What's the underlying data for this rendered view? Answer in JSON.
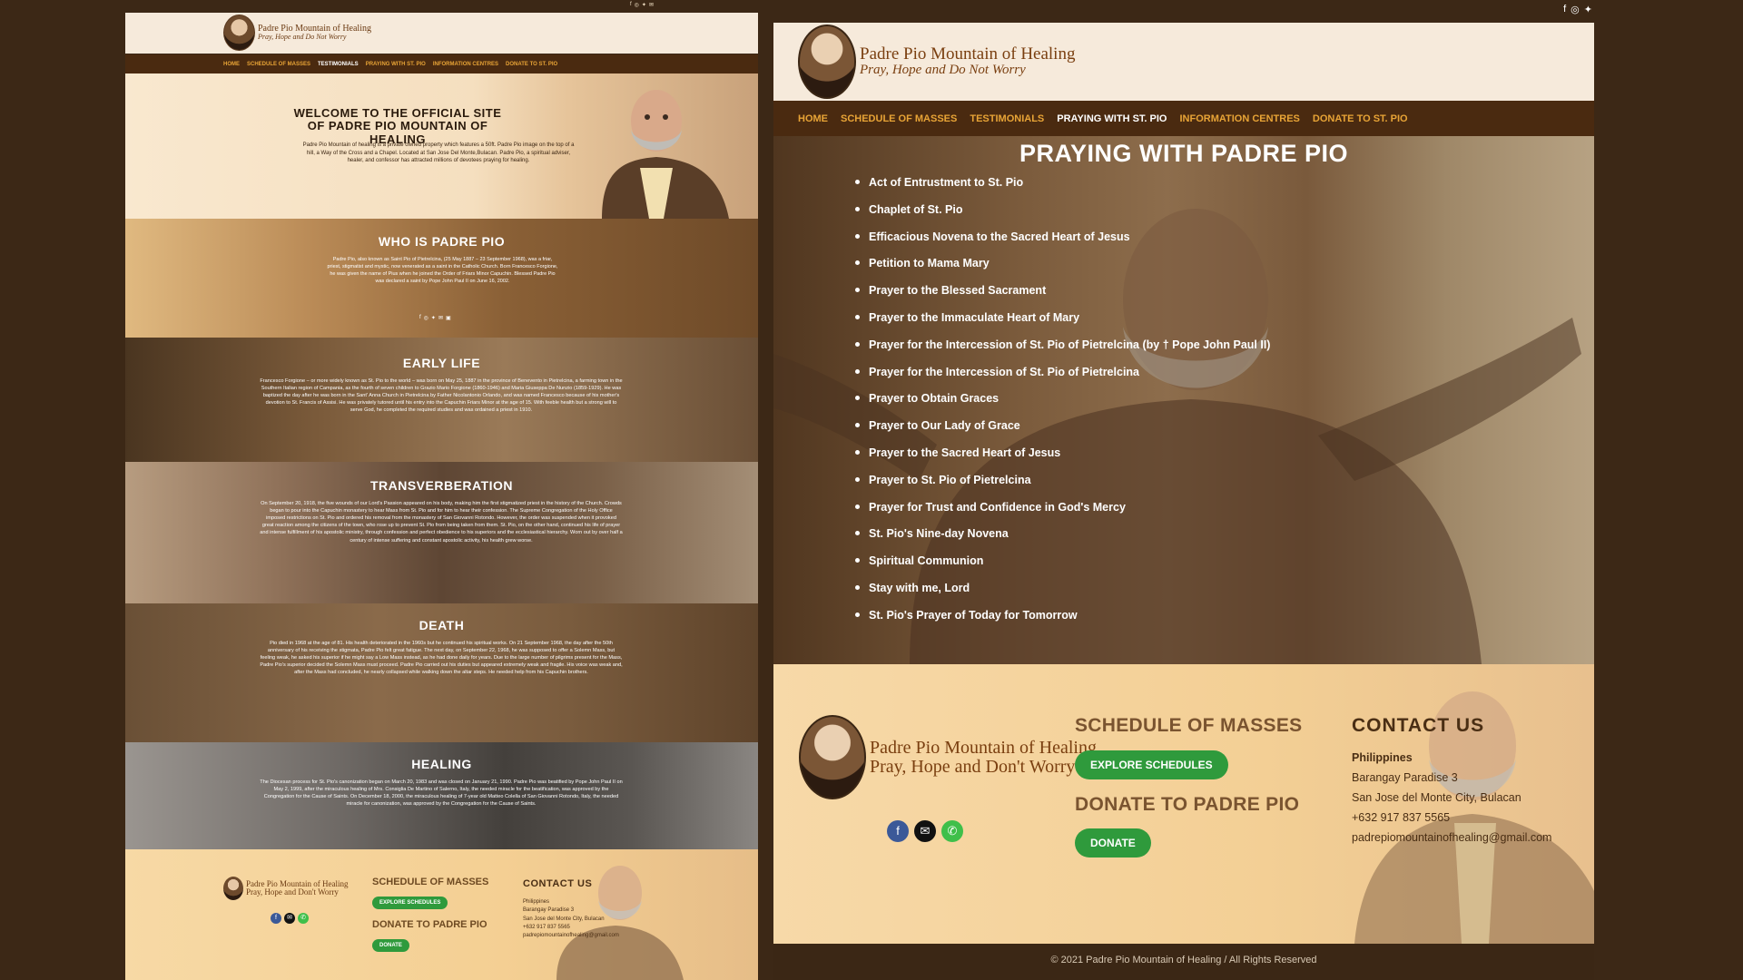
{
  "left_page": {
    "social_icons": [
      "facebook-icon",
      "instagram-icon",
      "twitter-icon",
      "email-icon"
    ],
    "logo": {
      "title": "Padre Pio Mountain of Healing",
      "tagline": "Pray, Hope and Do Not Worry"
    },
    "nav": [
      "HOME",
      "SCHEDULE OF MASSES",
      "TESTIMONIALS",
      "PRAYING WITH ST. PIO",
      "INFORMATION CENTRES",
      "DONATE TO ST. PIO"
    ],
    "nav_active": "TESTIMONIALS",
    "welcome": {
      "title": "WELCOME TO THE OFFICIAL SITE OF PADRE PIO MOUNTAIN OF HEALING",
      "text": "Padre Pio Mountain of healing is a private owned property which features a 50ft. Padre Pio image on the top of a hill, a Way of the Cross and a Chapel. Located at San Jose Del Monte,Bulacan. Padre Pio, a spiritual adviser, healer, and confessor has attracted millions of devotees praying for healing."
    },
    "who": {
      "title": "WHO IS PADRE PIO",
      "text": "Padre Pio, also known as Saint Pio of Pietrelcina, (25 May 1887 – 23 September 1968), was a friar, priest, stigmatist and mystic, now venerated as a saint in the Catholic Church. Born Francesco Forgione, he was given the name of Pius when he joined the Order of Friars Minor Capuchin. Blessed Padre Pio was declared a saint by Pope John Paul II on June 16, 2002."
    },
    "early": {
      "title": "EARLY LIFE",
      "text": "Francesco Forgione – or more widely known as St. Pio to the world – was born on May 25, 1887 in the province of Benevento in Pietrelcina, a farming town in the Southern Italian region of Campania, as the fourth of seven children to Grazio Mario Forgione (1860-1946) and Maria Giuseppa De Nunzio (1859-1929). He was baptized the day after he was born in the Sant' Anna Church in Pietrelcina by Father Nicolantonio Orlando, and was named Francesco because of his mother's devotion to St. Francis of Assisi. He was privately tutored until his entry into the Capuchin Friars Minor at the age of 15. With feeble health but a strong will to serve God, he completed the required studies and was ordained a priest in 1910."
    },
    "transverberation": {
      "title": "TRANSVERBERATION",
      "text": "On September 20, 1918, the five wounds of our Lord's Passion appeared on his body, making him the first stigmatized priest in the history of the Church. Crowds began to pour into the Capuchin monastery to hear Mass from St. Pio and for him to hear their confession. The Supreme Congregation of the Holy Office imposed restrictions on St. Pio and ordered his removal from the monastery of San Giovanni Rotondo. However, the order was suspended when it provoked great reaction among the citizens of the town, who rose up to prevent St. Pio from being taken from them. St. Pio, on the other hand, continued his life of prayer and intense fulfillment of his apostolic ministry, through confession and perfect obedience to his superiors and the ecclesiastical hierarchy. Worn out by over half a century of intense suffering and constant apostolic activity, his health grew worse."
    },
    "death": {
      "title": "DEATH",
      "text": "Pio died in 1968 at the age of 81. His health deteriorated in the 1960s but he continued his spiritual works. On 21 September 1968, the day after the 50th anniversary of his receiving the stigmata, Padre Pio felt great fatigue. The next day, on September 22, 1968, he was supposed to offer a Solemn Mass, but feeling weak, he asked his superior if he might say a Low Mass instead, as he had done daily for years. Due to the large number of pilgrims present for the Mass, Padre Pio's superior decided the Solemn Mass must proceed. Padre Pio carried out his duties but appeared extremely weak and fragile. His voice was weak and, after the Mass had concluded, he nearly collapsed while walking down the altar steps. He needed help from his Capuchin brothers."
    },
    "healing": {
      "title": "HEALING",
      "text": "The Diocesan process for St. Pio's canonization began on March 20, 1983 and was closed on January 21, 1990. Padre Pio was beatified by Pope John Paul II on May 2, 1999, after the miraculous healing of Mrs. Consiglia De Martino of Salerno, Italy, the needed miracle for the beatification, was approved by the Congregation for the Cause of Saints. On December 18, 2000, the miraculous healing of 7-year old Matteo Colella of San Giovanni Rotondo, Italy, the needed miracle for canonization, was approved by the Congregation for the Cause of Saints."
    },
    "footer": {
      "logo_title": "Padre Pio Mountain of Healing",
      "logo_tagline": "Pray, Hope and Don't Worry",
      "schedule_title": "SCHEDULE OF MASSES",
      "explore_btn": "EXPLORE SCHEDULES",
      "donate_title": "DONATE TO PADRE PIO",
      "donate_btn": "DONATE",
      "contact_title": "CONTACT US",
      "contact": [
        "Philippines",
        "Barangay Paradise 3",
        "San Jose del Monte City, Bulacan",
        "+632 917 837 5565",
        "padrepiomountainofhealing@gmail.com"
      ]
    }
  },
  "right_page": {
    "social_icons": [
      "facebook-icon",
      "instagram-icon",
      "twitter-icon"
    ],
    "logo": {
      "title": "Padre Pio Mountain of Healing",
      "tagline": "Pray, Hope and Do Not Worry"
    },
    "nav": [
      "HOME",
      "SCHEDULE OF MASSES",
      "TESTIMONIALS",
      "PRAYING WITH ST. PIO",
      "INFORMATION CENTRES",
      "DONATE TO ST. PIO"
    ],
    "nav_active": "PRAYING WITH ST. PIO",
    "heading": "PRAYING WITH PADRE PIO",
    "prayers": [
      "Act of Entrustment to St. Pio",
      "Chaplet of St. Pio",
      "Efficacious Novena to the Sacred Heart of Jesus",
      "Petition to Mama Mary",
      "Prayer to the Blessed Sacrament",
      "Prayer to the Immaculate Heart of Mary",
      "Prayer for the Intercession of St. Pio of Pietrelcina (by † Pope John Paul II)",
      "Prayer for the Intercession of St. Pio of Pietrelcina",
      "Prayer to Obtain Graces",
      "Prayer to Our Lady of Grace",
      "Prayer to the Sacred Heart of Jesus",
      "Prayer to St. Pio of Pietrelcina",
      "Prayer for Trust and Confidence in God's Mercy",
      "St. Pio's Nine-day Novena",
      "Spiritual Communion",
      "Stay with me, Lord",
      "St. Pio's Prayer of Today for Tomorrow"
    ],
    "footer": {
      "logo_title": "Padre Pio Mountain of Healing",
      "logo_tagline": "Pray, Hope and Don't Worry",
      "footer_icons": [
        "facebook-icon",
        "email-icon",
        "phone-icon"
      ],
      "schedule_title": "SCHEDULE OF MASSES",
      "explore_btn": "EXPLORE SCHEDULES",
      "donate_title": "DONATE TO PADRE PIO",
      "donate_btn": "DONATE",
      "contact_title": "CONTACT US",
      "contact": [
        "Philippines",
        "Barangay Paradise 3",
        "San Jose del Monte City, Bulacan",
        "+632 917 837 5565",
        "padrepiomountainofhealing@gmail.com"
      ]
    },
    "copyright": "© 2021 Padre Pio Mountain of Healing / All Rights Reserved"
  },
  "colors": {
    "background": "#3c2816",
    "nav_bg": "#4a2a10",
    "nav_link": "#e8a436",
    "header_bg": "#f6eadb",
    "footer_bg": "#f3cf95",
    "button_green": "#2f9a3c",
    "brand_brown": "#7a3f10"
  }
}
